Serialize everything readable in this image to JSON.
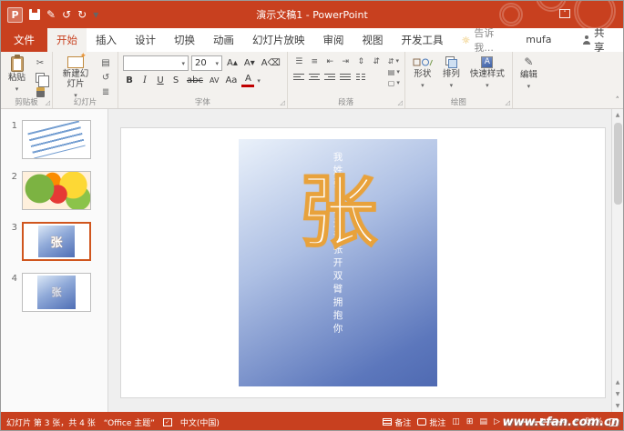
{
  "app": {
    "title": "演示文稿1 - PowerPoint"
  },
  "colors": {
    "brand": "#C8401F",
    "ribbon_bg": "#F3F1EE",
    "selection_border": "#D0561E",
    "slide_gradient_start": "#EAF1FA",
    "slide_gradient_end": "#4F6AB2",
    "big_char_outline": "#E8A23C"
  },
  "icons": {
    "pen": "✎",
    "undo": "↺",
    "redo": "↻",
    "caret": "▾",
    "chevron_up": "˄",
    "bulb": "☼",
    "scissors": "✂",
    "reset": "↺",
    "layout": "▤",
    "section": "≣",
    "grow_font": "A▴",
    "shrink_font": "A▾",
    "clear_format": "A⌫",
    "bullets": "☰",
    "numbering": "≡",
    "outdent": "⇤",
    "indent": "⇥",
    "line_spacing": "⇕",
    "direction": "⇵",
    "shape_square": "▢",
    "shape_circle": "○",
    "shape_diamond": "◇",
    "up_arrow": "▲",
    "down_arrow": "▼",
    "minus": "−",
    "plus": "+",
    "view_normal": "◫",
    "view_sorter": "⊞",
    "view_reading": "▤",
    "view_show": "▷",
    "bold": "B",
    "italic": "I",
    "underline": "U",
    "shadow": "S",
    "strike": "abc",
    "kerning": "AV",
    "case": "Aa",
    "font_color": "A",
    "check": "✓",
    "app_initial": "P"
  },
  "tabs": {
    "file": "文件",
    "items": [
      "开始",
      "插入",
      "设计",
      "切换",
      "动画",
      "幻灯片放映",
      "审阅",
      "视图",
      "开发工具"
    ],
    "selected": "开始",
    "tell_me": "告诉我...",
    "user": "mufa yu",
    "share": "共享"
  },
  "ribbon": {
    "clipboard": {
      "label": "剪贴板",
      "paste": "粘贴"
    },
    "slides": {
      "label": "幻灯片",
      "new_slide": "新建幻灯片"
    },
    "font": {
      "label": "字体",
      "size": "20"
    },
    "paragraph": {
      "label": "段落"
    },
    "drawing": {
      "label": "绘图",
      "shapes": "形状",
      "arrange": "排列",
      "quick_styles": "快速样式"
    },
    "editing": {
      "label": "编辑"
    }
  },
  "slides_panel": {
    "slides": [
      {
        "number": "1"
      },
      {
        "number": "2"
      },
      {
        "number": "3",
        "char": "张",
        "selected": true
      },
      {
        "number": "4",
        "char": "张"
      }
    ]
  },
  "slide": {
    "vertical_text": "我姓张，却无法张开双臂拥抱你",
    "big_char": "张"
  },
  "status": {
    "slide_info": "幻灯片 第 3 张，共 4 张",
    "theme": "“Office 主题”",
    "language": "中文(中国)",
    "notes": "备注",
    "comments": "批注",
    "zoom": "53%",
    "watermark": "www.cfan.com.cn"
  }
}
